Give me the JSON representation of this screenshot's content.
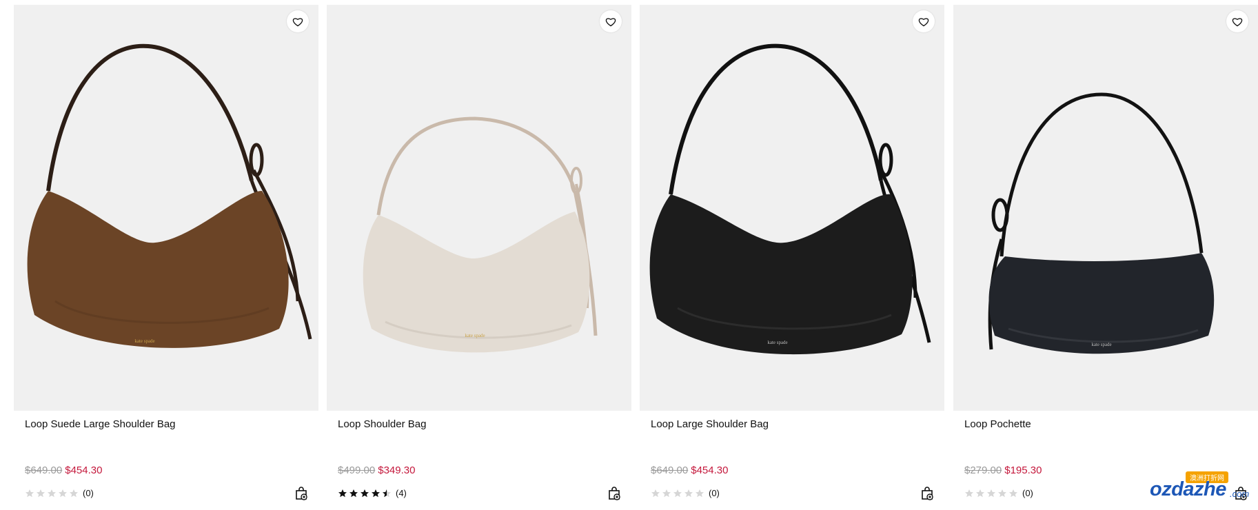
{
  "products": [
    {
      "title": "Loop Suede Large Shoulder Bag",
      "original_price": "$649.00",
      "sale_price": "$454.30",
      "rating": 0,
      "review_count": "(0)",
      "bag_color": "#6b4426",
      "strap_color": "#2c1e16",
      "wishlist_icon": "heart-icon",
      "cart_icon": "shopping-bag-plus-icon"
    },
    {
      "title": "Loop Shoulder Bag",
      "original_price": "$499.00",
      "sale_price": "$349.30",
      "rating": 4.5,
      "review_count": "(4)",
      "bag_color": "#e3dcd3",
      "strap_color": "#c9b9aa",
      "wishlist_icon": "heart-icon",
      "cart_icon": "shopping-bag-plus-icon"
    },
    {
      "title": "Loop Large Shoulder Bag",
      "original_price": "$649.00",
      "sale_price": "$454.30",
      "rating": 0,
      "review_count": "(0)",
      "bag_color": "#1c1c1c",
      "strap_color": "#111111",
      "wishlist_icon": "heart-icon",
      "cart_icon": "shopping-bag-plus-icon"
    },
    {
      "title": "Loop Pochette",
      "original_price": "$279.00",
      "sale_price": "$195.30",
      "rating": 0,
      "review_count": "(0)",
      "bag_color": "#22252b",
      "strap_color": "#121212",
      "wishlist_icon": "heart-icon",
      "cart_icon": "shopping-bag-plus-icon"
    }
  ],
  "colors": {
    "sale": "#c4173b",
    "strike": "#9a9a9a",
    "image_bg": "#f0f0f0",
    "star_filled": "#111111",
    "star_empty": "#d6d6d6"
  },
  "watermark": {
    "text": "ozdazhe",
    "suffix": ".com",
    "badge": "澳洲打折网"
  }
}
